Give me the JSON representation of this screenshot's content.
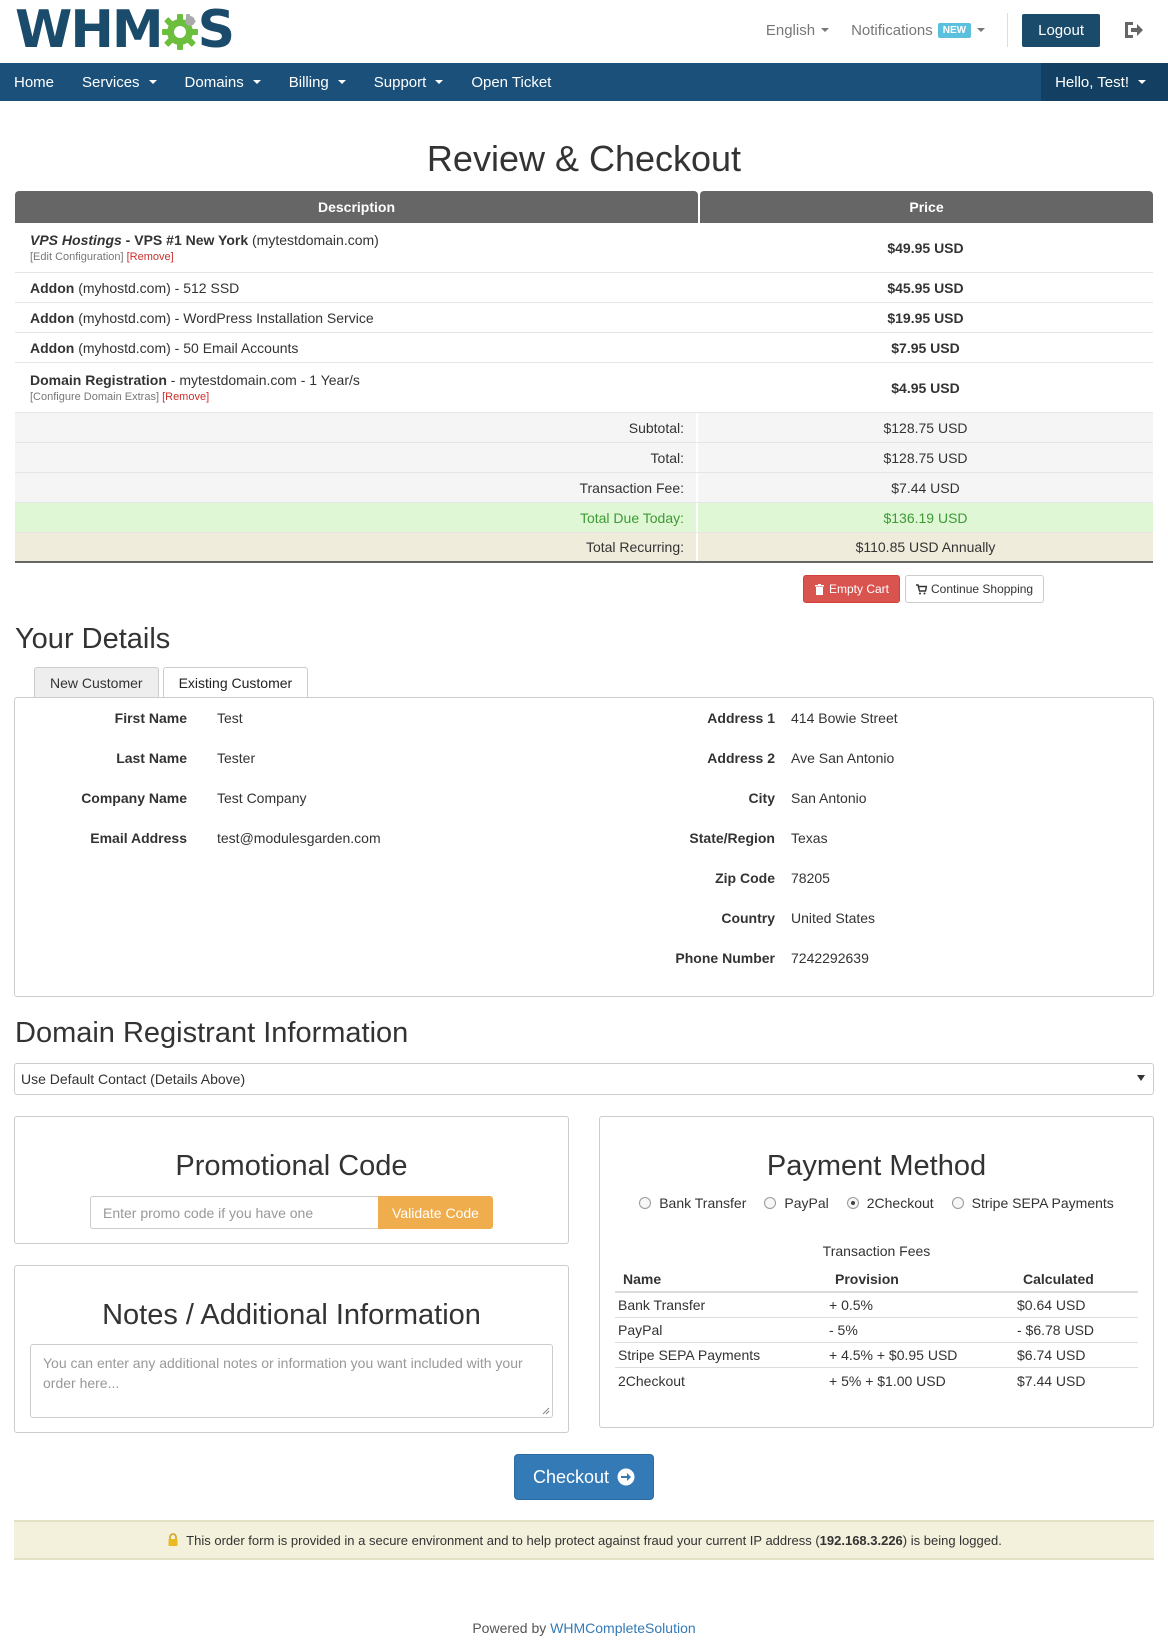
{
  "header": {
    "logo_text_left": "WHM",
    "logo_text_right": "S",
    "language": "English",
    "notifications": "Notifications",
    "notifications_badge": "NEW",
    "logout": "Logout",
    "icons": [
      "gear-icon",
      "logout-icon"
    ]
  },
  "nav": {
    "items": [
      {
        "label": "Home",
        "dropdown": false
      },
      {
        "label": "Services",
        "dropdown": true
      },
      {
        "label": "Domains",
        "dropdown": true
      },
      {
        "label": "Billing",
        "dropdown": true
      },
      {
        "label": "Support",
        "dropdown": true
      },
      {
        "label": "Open Ticket",
        "dropdown": false
      }
    ],
    "user": "Hello, Test!"
  },
  "page_title": "Review & Checkout",
  "cart": {
    "col_description": "Description",
    "col_price": "Price",
    "items": [
      {
        "group": "VPS Hostings",
        "sep": " - ",
        "name": "VPS #1 New York",
        "extra": " (mytestdomain.com)",
        "link1": "[Edit Configuration]",
        "link2": "[Remove]",
        "price": "$49.95 USD"
      },
      {
        "name": "Addon",
        "extra": " (myhostd.com) - 512 SSD",
        "price": "$45.95 USD"
      },
      {
        "name": "Addon",
        "extra": " (myhostd.com) - WordPress Installation Service",
        "price": "$19.95 USD"
      },
      {
        "name": "Addon",
        "extra": " (myhostd.com) - 50 Email Accounts",
        "price": "$7.95 USD"
      },
      {
        "name": "Domain Registration",
        "extra": " - mytestdomain.com - 1 Year/s",
        "link1": "[Configure Domain Extras]",
        "link2": "[Remove]",
        "price": "$4.95 USD"
      }
    ],
    "totals": {
      "subtotal_label": "Subtotal:",
      "subtotal": "$128.75 USD",
      "total_label": "Total:",
      "total": "$128.75 USD",
      "fee_label": "Transaction Fee:",
      "fee": "$7.44 USD",
      "due_label": "Total Due Today:",
      "due": "$136.19 USD",
      "recurring_label": "Total Recurring:",
      "recurring": "$110.85 USD Annually"
    },
    "empty_cart": "Empty Cart",
    "continue_shopping": "Continue Shopping"
  },
  "details": {
    "title": "Your Details",
    "tab_new": "New Customer",
    "tab_existing": "Existing Customer",
    "left": [
      {
        "label": "First Name",
        "value": "Test"
      },
      {
        "label": "Last Name",
        "value": "Tester"
      },
      {
        "label": "Company Name",
        "value": "Test Company"
      },
      {
        "label": "Email Address",
        "value": "test@modulesgarden.com"
      }
    ],
    "right": [
      {
        "label": "Address 1",
        "value": "414 Bowie Street"
      },
      {
        "label": "Address 2",
        "value": "Ave San Antonio"
      },
      {
        "label": "City",
        "value": "San Antonio"
      },
      {
        "label": "State/Region",
        "value": "Texas"
      },
      {
        "label": "Zip Code",
        "value": "78205"
      },
      {
        "label": "Country",
        "value": "United States"
      },
      {
        "label": "Phone Number",
        "value": "7242292639"
      }
    ]
  },
  "registrant": {
    "title": "Domain Registrant Information",
    "selected": "Use Default Contact (Details Above)"
  },
  "promo": {
    "title": "Promotional Code",
    "placeholder": "Enter promo code if you have one",
    "button": "Validate Code"
  },
  "notes": {
    "title": "Notes / Additional Information",
    "placeholder": "You can enter any additional notes or information you want included with your order here..."
  },
  "payment": {
    "title": "Payment Method",
    "options": [
      {
        "label": "Bank Transfer",
        "checked": false
      },
      {
        "label": "PayPal",
        "checked": false
      },
      {
        "label": "2Checkout",
        "checked": true
      },
      {
        "label": "Stripe SEPA Payments",
        "checked": false
      }
    ],
    "fees_caption": "Transaction Fees",
    "fees_headers": [
      "Name",
      "Provision",
      "Calculated"
    ],
    "fees_rows": [
      [
        "Bank Transfer",
        "+ 0.5%",
        "$0.64 USD"
      ],
      [
        "PayPal",
        "- 5%",
        "- $6.78 USD"
      ],
      [
        "Stripe SEPA Payments",
        "+ 4.5% + $0.95 USD",
        "$6.74 USD"
      ],
      [
        "2Checkout",
        "+ 5% + $1.00 USD",
        "$7.44 USD"
      ]
    ]
  },
  "checkout": "Checkout",
  "secure": {
    "text_before": "This order form is provided in a secure environment and to help protect against fraud your current IP address (",
    "ip": "192.168.3.226",
    "text_after": ") is being logged."
  },
  "footer": {
    "powered_by": "Powered by ",
    "link": "WHMCompleteSolution"
  },
  "colors": {
    "brand": "#1a4b6b",
    "nav": "#1a5079",
    "danger": "#d9534f",
    "warning": "#f0ad4e",
    "primary": "#337ab7",
    "success_bg": "#dff7d5"
  }
}
